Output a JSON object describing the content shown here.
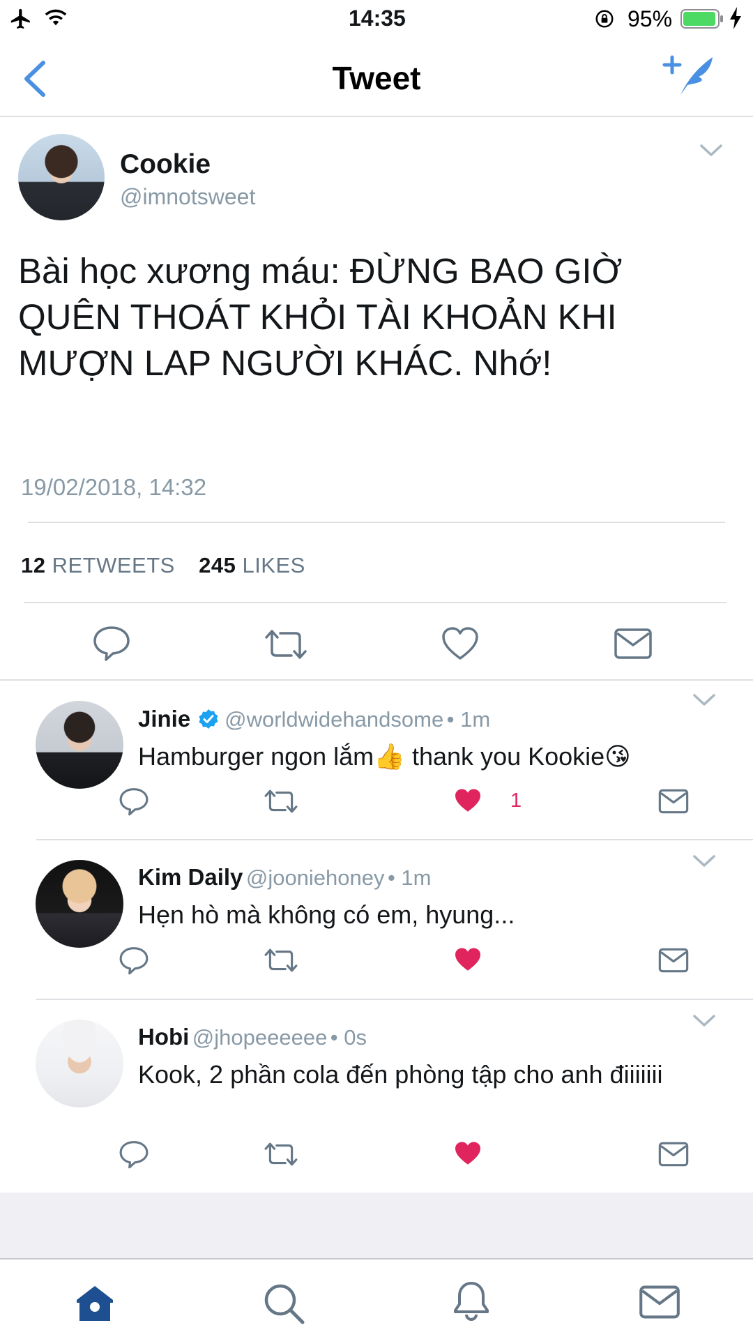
{
  "status_bar": {
    "time": "14:35",
    "battery": "95%"
  },
  "nav": {
    "title": "Tweet"
  },
  "main_tweet": {
    "name": "Cookie",
    "handle": "@imnotsweet",
    "text": "Bài học xương máu: ĐỪNG BAO GIỜ\nQUÊN THOÁT KHỎI TÀI KHOẢN KHI\nMƯỢN LAP NGƯỜI KHÁC. Nhớ!",
    "timestamp": "19/02/2018, 14:32",
    "retweets_count": "12",
    "retweets_label": "RETWEETS",
    "likes_count": "245",
    "likes_label": "LIKES"
  },
  "replies": [
    {
      "name": "Jinie",
      "verified": true,
      "handle": "@worldwidehandsome",
      "time": "• 1m",
      "text": "Hamburger ngon lắm👍 thank you Kookie😘",
      "like_count": "1"
    },
    {
      "name": "Kim Daily",
      "handle": "@jooniehoney",
      "time": "• 1m",
      "text": "Hẹn hò mà không có em, hyung..."
    },
    {
      "name": "Hobi",
      "handle": "@jhopeeeeee",
      "time": "• 0s",
      "text": "Kook, 2 phần cola đến phòng tập cho anh điiiiiii"
    }
  ],
  "icons": {
    "accent": "#4a90e2",
    "like_active": "#e0245e",
    "icon_gray": "#657786",
    "tab_active": "#1d4f91"
  }
}
